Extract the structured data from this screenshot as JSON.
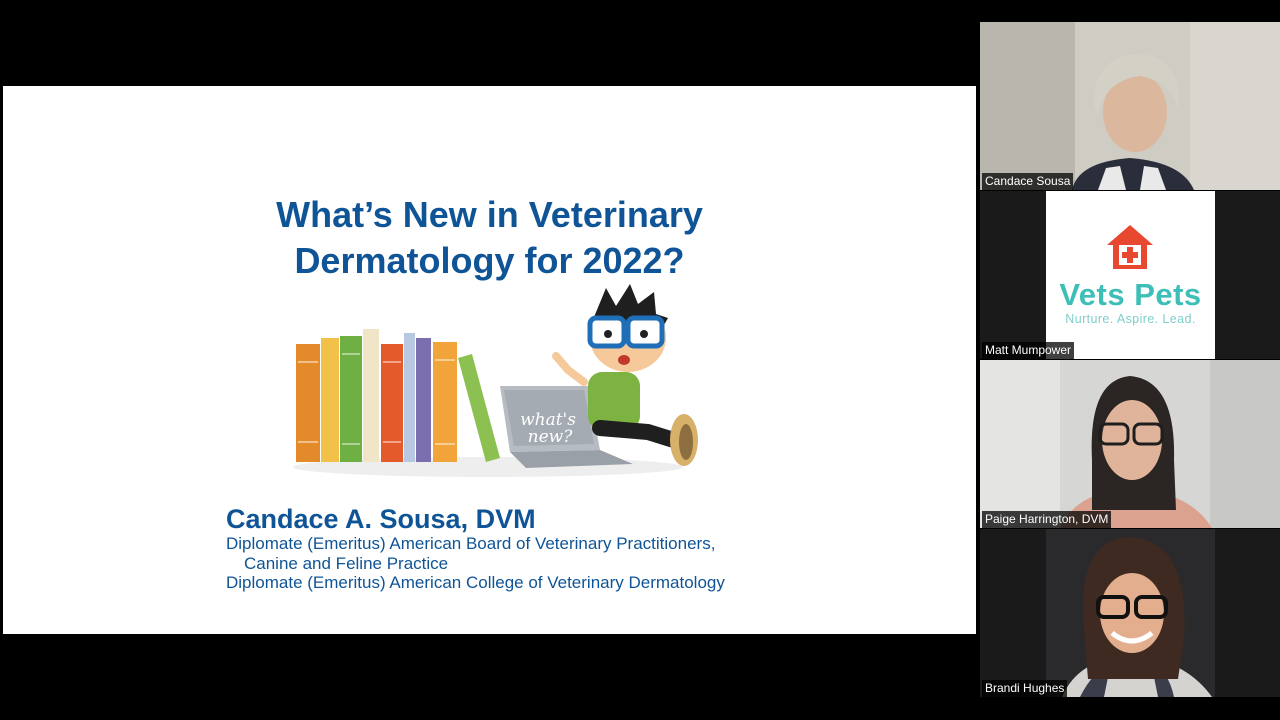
{
  "slide": {
    "title_line1": "What’s New in Veterinary",
    "title_line2": "Dermatology for 2022?",
    "laptop_text_1": "what's",
    "laptop_text_2": "new?",
    "presenter_name": "Candace A. Sousa, DVM",
    "credentials": [
      "Diplomate (Emeritus) American Board of Veterinary Practitioners,",
      "Canine and Feline Practice",
      "Diplomate (Emeritus) American College of Veterinary Dermatology"
    ]
  },
  "participants": [
    {
      "name": "Candace Sousa"
    },
    {
      "name": "Matt Mumpower",
      "logo_brand": "Vets Pets",
      "logo_tagline": "Nurture. Aspire. Lead."
    },
    {
      "name": "Paige Harrington, DVM"
    },
    {
      "name": "Brandi Hughes"
    }
  ],
  "colors": {
    "title_blue": "#0f5496",
    "brand_teal": "#3dbfb8",
    "logo_red": "#e8482f",
    "background": "#000000"
  }
}
